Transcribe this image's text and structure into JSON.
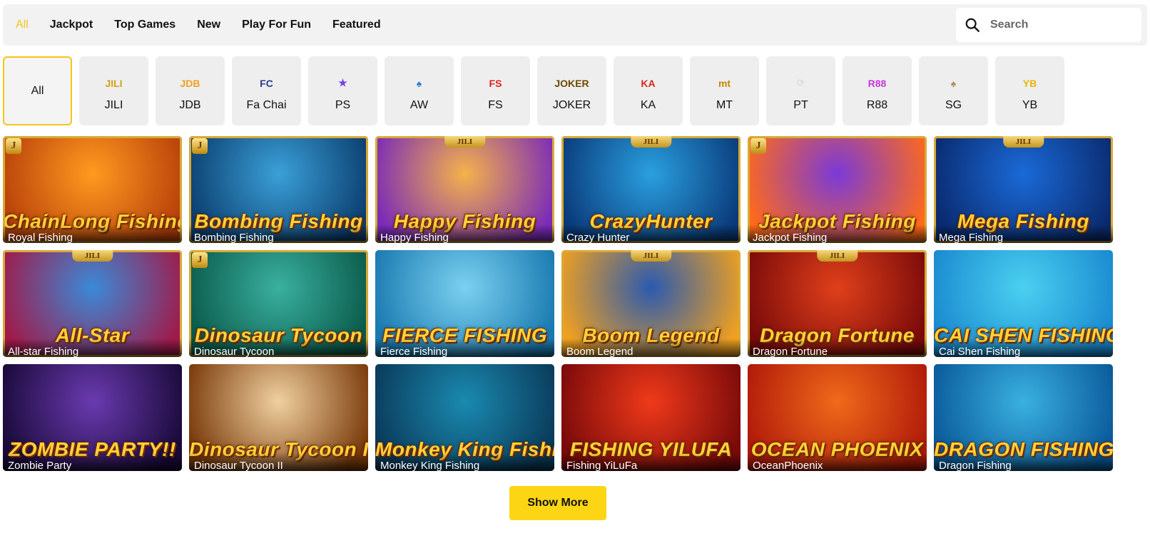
{
  "nav": {
    "tabs": [
      {
        "label": "All",
        "active": true
      },
      {
        "label": "Jackpot",
        "active": false
      },
      {
        "label": "Top Games",
        "active": false
      },
      {
        "label": "New",
        "active": false
      },
      {
        "label": "Play For Fun",
        "active": false
      },
      {
        "label": "Featured",
        "active": false
      }
    ],
    "search_placeholder": "Search"
  },
  "providers": [
    {
      "label": "All",
      "logo_text": "",
      "color": "#111111",
      "active": true
    },
    {
      "label": "JILI",
      "logo_text": "JILI",
      "color": "#d4a017",
      "active": false
    },
    {
      "label": "JDB",
      "logo_text": "JDB",
      "color": "#f0a020",
      "active": false
    },
    {
      "label": "Fa Chai",
      "logo_text": "FC",
      "color": "#2a3c8f",
      "active": false
    },
    {
      "label": "PS",
      "logo_text": "★",
      "color": "#7b3fe4",
      "active": false
    },
    {
      "label": "AW",
      "logo_text": "♠",
      "color": "#2b7bd6",
      "active": false
    },
    {
      "label": "FS",
      "logo_text": "FS",
      "color": "#e02020",
      "active": false
    },
    {
      "label": "JOKER",
      "logo_text": "JOKER",
      "color": "#6b4a00",
      "active": false
    },
    {
      "label": "KA",
      "logo_text": "KA",
      "color": "#d12a1f",
      "active": false
    },
    {
      "label": "MT",
      "logo_text": "mt",
      "color": "#c8860a",
      "active": false
    },
    {
      "label": "PT",
      "logo_text": "⟳",
      "color": "#dddddd",
      "active": false
    },
    {
      "label": "R88",
      "logo_text": "R88",
      "color": "#c43ad6",
      "active": false
    },
    {
      "label": "SG",
      "logo_text": "♠",
      "color": "#b58a5a",
      "active": false
    },
    {
      "label": "YB",
      "logo_text": "YB",
      "color": "#e6b800",
      "active": false
    }
  ],
  "games": [
    {
      "name": "Royal Fishing",
      "art_title": "ChainLong Fishing",
      "badge": "J",
      "jili_tag": "",
      "bg": [
        "#ff9a1f",
        "#b8400a"
      ]
    },
    {
      "name": "Bombing Fishing",
      "art_title": "Bombing Fishing",
      "badge": "J",
      "jili_tag": "",
      "bg": [
        "#3aa0d8",
        "#0b3d6e"
      ]
    },
    {
      "name": "Happy Fishing",
      "art_title": "Happy Fishing",
      "badge": "",
      "jili_tag": "JILI",
      "bg": [
        "#f5b24a",
        "#7a2ab8"
      ]
    },
    {
      "name": "Crazy Hunter",
      "art_title": "CrazyHunter",
      "badge": "",
      "jili_tag": "JILI",
      "bg": [
        "#2aa0e0",
        "#0a3a7a"
      ]
    },
    {
      "name": "Jackpot Fishing",
      "art_title": "Jackpot Fishing",
      "badge": "J",
      "jili_tag": "",
      "bg": [
        "#7a3ad8",
        "#ff6a1a"
      ]
    },
    {
      "name": "Mega Fishing",
      "art_title": "Mega Fishing",
      "badge": "",
      "jili_tag": "JILI",
      "bg": [
        "#1a6ad8",
        "#0a2a6e"
      ]
    },
    {
      "name": "All-star Fishing",
      "art_title": "All-Star",
      "badge": "",
      "jili_tag": "JILI",
      "bg": [
        "#3a8ad8",
        "#a01a4a"
      ]
    },
    {
      "name": "Dinosaur Tycoon",
      "art_title": "Dinosaur Tycoon",
      "badge": "J",
      "jili_tag": "",
      "bg": [
        "#3ab0a0",
        "#0a5a4a"
      ]
    },
    {
      "name": "Fierce Fishing",
      "art_title": "FIERCE FISHING",
      "badge": "",
      "jili_tag": "",
      "bg": [
        "#7ad0f0",
        "#1a7ab0"
      ]
    },
    {
      "name": "Boom Legend",
      "art_title": "Boom Legend",
      "badge": "",
      "jili_tag": "JILI",
      "bg": [
        "#2a5ab0",
        "#f0a020"
      ]
    },
    {
      "name": "Dragon Fortune",
      "art_title": "Dragon Fortune",
      "badge": "",
      "jili_tag": "JILI",
      "bg": [
        "#e0401a",
        "#7a0a0a"
      ]
    },
    {
      "name": "Cai Shen Fishing",
      "art_title": "CAI SHEN FISHING",
      "badge": "",
      "jili_tag": "",
      "bg": [
        "#4ad0f0",
        "#1a8ad0"
      ]
    },
    {
      "name": "Zombie Party",
      "art_title": "ZOMBIE PARTY!!",
      "badge": "",
      "jili_tag": "",
      "bg": [
        "#6a3ab0",
        "#1a0a3a"
      ]
    },
    {
      "name": "Dinosaur Tycoon II",
      "art_title": "Dinosaur Tycoon II",
      "badge": "",
      "jili_tag": "",
      "bg": [
        "#f0d0a0",
        "#7a3a0a"
      ]
    },
    {
      "name": "Monkey King Fishing",
      "art_title": "Monkey King Fishing",
      "badge": "",
      "jili_tag": "",
      "bg": [
        "#1a8ab0",
        "#0a3a5a"
      ]
    },
    {
      "name": "Fishing YiLuFa",
      "art_title": "FISHING YILUFA",
      "badge": "",
      "jili_tag": "",
      "bg": [
        "#f03a1a",
        "#7a0a0a"
      ]
    },
    {
      "name": "OceanPhoenix",
      "art_title": "OCEAN PHOENIX",
      "badge": "",
      "jili_tag": "",
      "bg": [
        "#f06a1a",
        "#b01a0a"
      ]
    },
    {
      "name": "Dragon Fishing",
      "art_title": "DRAGON FISHING",
      "badge": "",
      "jili_tag": "",
      "bg": [
        "#3ab0e0",
        "#0a5a9a"
      ]
    }
  ],
  "show_more_label": "Show More"
}
